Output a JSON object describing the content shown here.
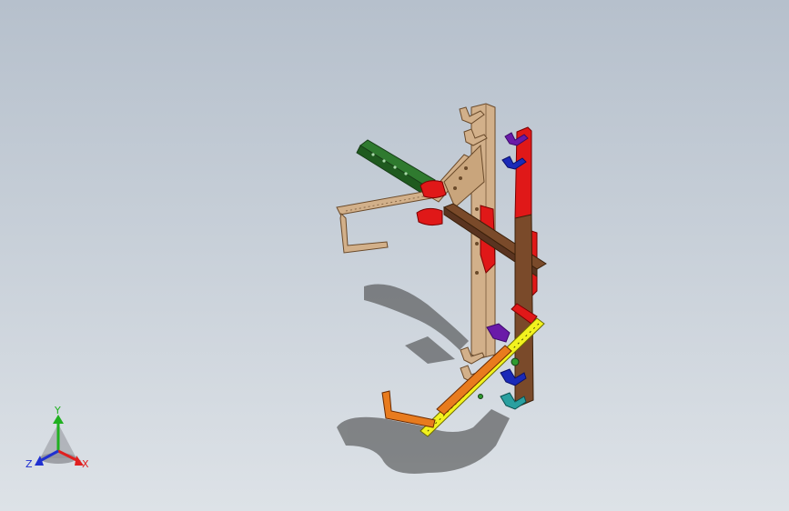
{
  "viewport": {
    "background_top": "#b6c0cc",
    "background_bottom": "#dde2e7"
  },
  "model": {
    "colors": {
      "tan": "#d2b08a",
      "red": "#e01818",
      "brown": "#7a4a2a",
      "green": "#2f7a2f",
      "orange": "#e87b1e",
      "yellow": "#f2f21e",
      "purple": "#6a1aa8",
      "blue": "#1a2ab8",
      "teal": "#2aa0a0",
      "shadow": "#3a3a3a"
    }
  },
  "triad": {
    "x_label": "X",
    "y_label": "Y",
    "z_label": "Z",
    "x_color": "#e02020",
    "y_color": "#20b020",
    "z_color": "#2030d0"
  }
}
